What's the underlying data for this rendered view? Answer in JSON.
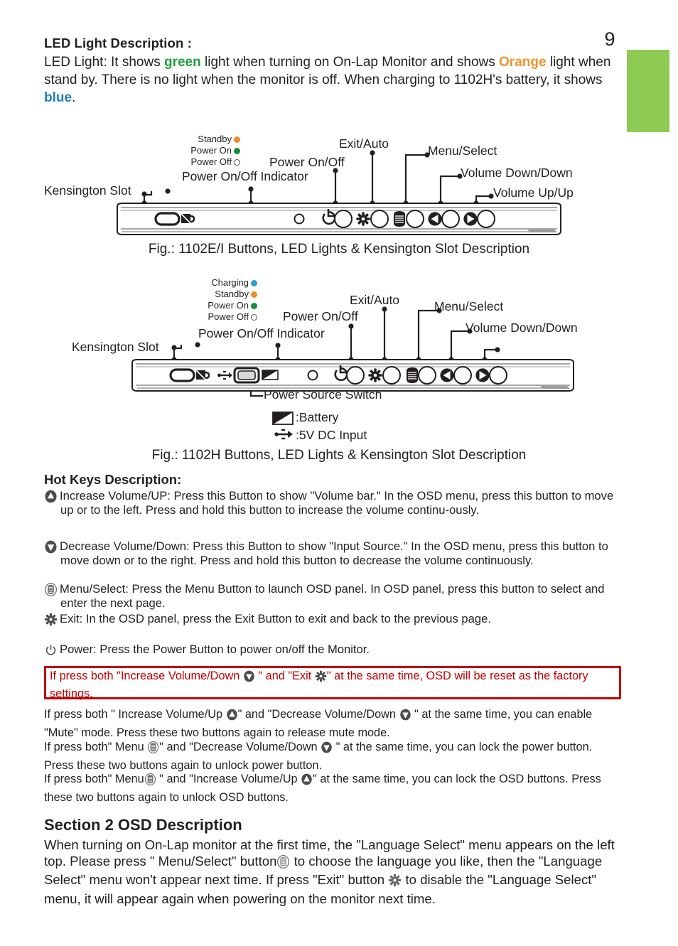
{
  "page_number": "9",
  "accent_colors": {
    "green_tab": "#8dcb55",
    "green_text": "#1f9d3a",
    "orange_text": "#f0922e",
    "blue_text": "#1f7fc4",
    "warning_red": "#c00000"
  },
  "led_section": {
    "title": "LED Light Description  :",
    "text_1": "LED Light: It shows ",
    "word_green": "green",
    "text_2": " light when turning on On-Lap Monitor and  shows ",
    "word_orange": "Orange",
    "text_3": " light when stand by. There is no light when the monitor is off. When charging to 1102H's battery, it shows ",
    "word_blue": "blue",
    "text_4": "."
  },
  "figure1": {
    "caption": "Fig.: 1102E/I Buttons, LED Lights & Kensington Slot Description",
    "legend": [
      {
        "label": "Standby",
        "color": "orange"
      },
      {
        "label": "Power On",
        "color": "green"
      },
      {
        "label": "Power Off",
        "color": "white"
      }
    ],
    "callouts": [
      {
        "name": "kensington-slot",
        "label": "Kensington Slot"
      },
      {
        "name": "power-on-off-indicator",
        "label": "Power On/Off Indicator"
      },
      {
        "name": "power-on-off",
        "label": "Power On/Off"
      },
      {
        "name": "exit-auto",
        "label": "Exit/Auto"
      },
      {
        "name": "menu-select",
        "label": "Menu/Select"
      },
      {
        "name": "volume-down",
        "label": "Volume Down/Down"
      },
      {
        "name": "volume-up",
        "label": "Volume Up/Up"
      }
    ]
  },
  "figure2": {
    "caption": "Fig.: 1102H Buttons, LED Lights & Kensington Slot Description",
    "legend": [
      {
        "label": "Charging",
        "color": "blue"
      },
      {
        "label": "Standby",
        "color": "orange"
      },
      {
        "label": "Power On",
        "color": "green"
      },
      {
        "label": "Power Off",
        "color": "white"
      }
    ],
    "callouts": [
      {
        "name": "kensington-slot",
        "label": "Kensington Slot"
      },
      {
        "name": "power-on-off-indicator",
        "label": "Power On/Off Indicator"
      },
      {
        "name": "power-on-off",
        "label": "Power On/Off"
      },
      {
        "name": "exit-auto",
        "label": "Exit/Auto"
      },
      {
        "name": "menu-select",
        "label": "Menu/Select"
      },
      {
        "name": "volume-down",
        "label": "Volume Down/Down"
      },
      {
        "name": "power-source-switch",
        "label": "Power Source Switch"
      }
    ],
    "key_battery": ":Battery",
    "key_dc": ":5V DC Input"
  },
  "hotkeys": {
    "title": "Hot Keys Description:",
    "items": [
      {
        "icon": "volume-up-icon",
        "text": "Increase Volume/UP: Press this Button to show \"Volume bar.\" In the OSD menu, press this button to move up or to the left. Press  and hold  this button to  increase the volume continu-ously."
      },
      {
        "icon": "volume-down-icon",
        "text": "Decrease Volume/Down: Press this Button to show \"Input Source.\" In the OSD menu, press this button to move down or to the right. Press and hold  this button to decrease the volume continuously."
      },
      {
        "icon": "menu-icon",
        "text": "Menu/Select: Press the Menu Button to launch OSD panel. In OSD panel, press this button to select and enter the next page."
      },
      {
        "icon": "gear-exit-icon",
        "text": "Exit: In the OSD panel, press the Exit Button to exit and back to the previous page."
      },
      {
        "icon": "power-icon",
        "text": "Power: Press the Power Button to power on/off the Monitor."
      }
    ]
  },
  "warning": {
    "part_1": "If press  both \"Increase Volume/Down ",
    "part_2": " \" and \"Exit ",
    "part_3": "\" at the same time, OSD will be reset as the factory settings."
  },
  "notes": [
    {
      "part_1": "If press both \" Increase Volume/Up ",
      "part_2": "\" and \"Decrease Volume/Down ",
      "part_3": " \" at the same time, you can enable \"Mute\" mode. Press these two buttons again to release mute mode."
    },
    {
      "part_1": "If press both\" Menu ",
      "part_2": "\" and \"Decrease Volume/Down ",
      "part_3": " \" at the same time, you can lock the power button. Press these two buttons again to unlock power button."
    },
    {
      "part_1": " If press both\" Menu",
      "part_2": " \" and \"Increase Volume/Up ",
      "part_3": "\" at the same time, you can lock the OSD buttons. Press these two buttons again to unlock OSD buttons."
    }
  ],
  "section2": {
    "title": "Section 2  OSD Description",
    "part_1": "When turning on On-Lap monitor at the first time, the \"Language Select\" menu appears  on the left top. Please press \" Menu/Select\" button",
    "part_2": " to choose the language you like, then the \"Language Select\" menu won't appear next time. If press \"Exit\" button ",
    "part_3": " to disable the \"Language Select\" menu, it will appear again when powering on the monitor next time."
  }
}
